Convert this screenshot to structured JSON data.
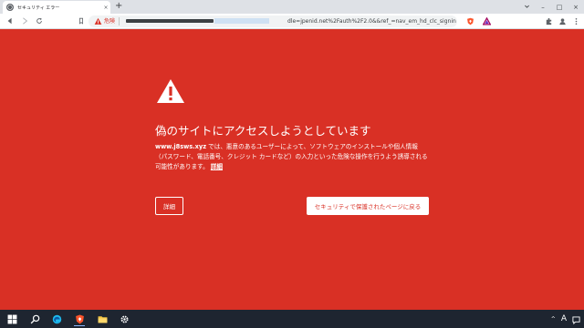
{
  "tab": {
    "title": "セキュリティ エラー",
    "close_label": "×",
    "new_tab_label": "+"
  },
  "window_controls": {
    "minimize": "–",
    "maximize": "□",
    "close": "×"
  },
  "toolbar": {
    "omnibox": {
      "danger_label": "危険",
      "url_visible": "dle=jpenid.net%2Fauth%2F2.0&&ref_=nav_em_hd_clc_signin"
    }
  },
  "interstitial": {
    "headline": "偽のサイトにアクセスしようとしています",
    "site": "www.j8sws.xyz",
    "description": " では、悪意のあるユーザーによって、ソフトウェアのインストールや個人情報（パスワード、電話番号、クレジット カードなど）の入力といった危険な操作を行うよう誘導される可能性があります。",
    "details_link": "詳細",
    "details_button": "詳細",
    "back_button": "セキュリティで保護されたページに戻る"
  },
  "taskbar": {
    "tray": {
      "chevron": "^",
      "ime": "A"
    }
  },
  "colors": {
    "danger_background": "#d93025",
    "tab_strip": "#dee1e6",
    "taskbar": "#1e2530"
  },
  "icons": [
    "warning-icon",
    "back-icon",
    "forward-icon",
    "reload-icon",
    "bookmark-icon",
    "brave-shield-icon",
    "brave-rewards-icon",
    "extensions-icon",
    "profile-icon",
    "menu-icon",
    "windows-start-icon",
    "search-icon",
    "edge-icon",
    "brave-icon",
    "file-explorer-icon",
    "settings-icon",
    "notification-icon"
  ]
}
